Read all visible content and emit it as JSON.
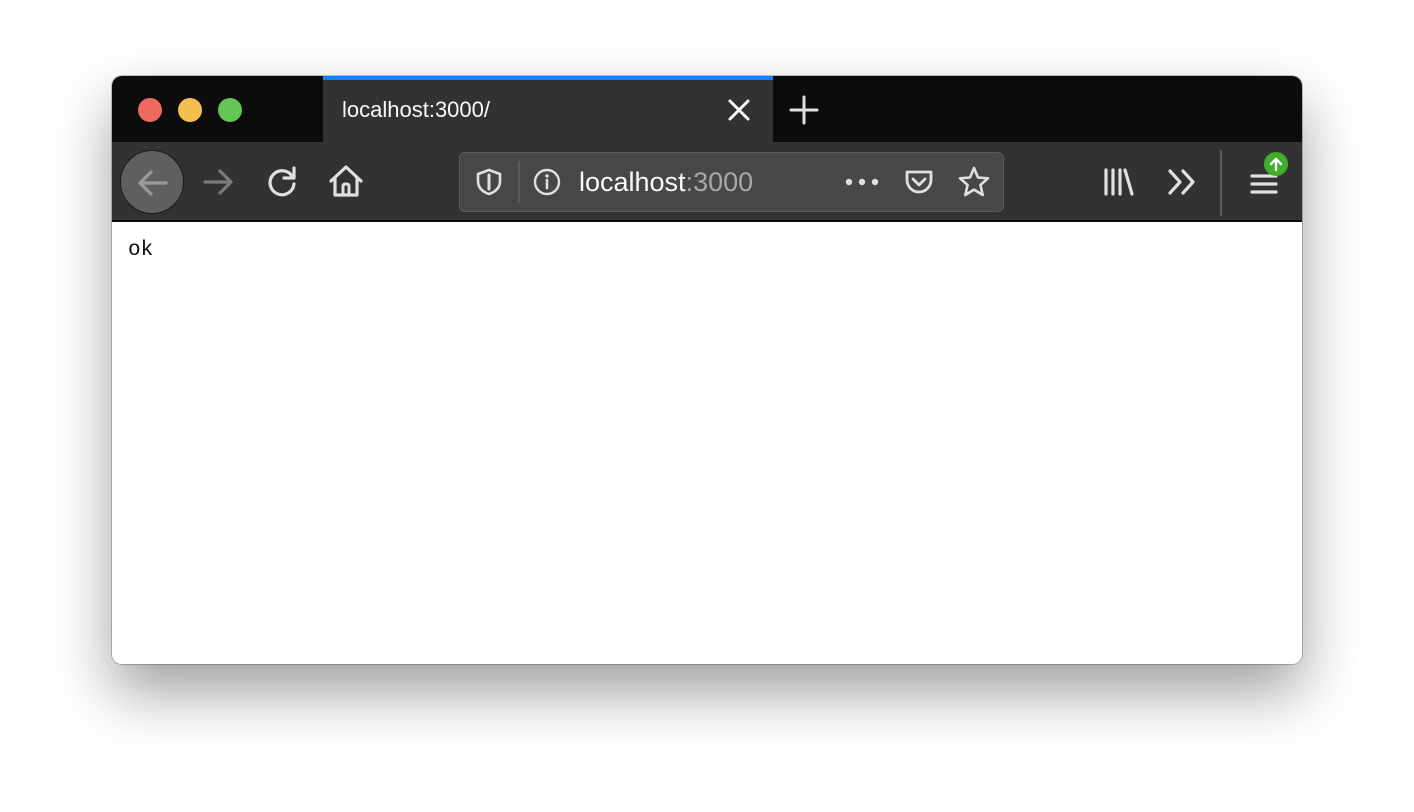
{
  "tab": {
    "title": "localhost:3000/"
  },
  "urlbar": {
    "host": "localhost",
    "port": ":3000"
  },
  "page": {
    "body_text": "ok"
  },
  "icons": {
    "close": "close-icon",
    "new_tab": "plus-icon",
    "back": "arrow-left-icon",
    "forward": "arrow-right-icon",
    "reload": "reload-icon",
    "home": "home-icon",
    "tracking": "shield-icon",
    "site_info": "info-icon",
    "page_actions": "ellipsis-icon",
    "pocket": "pocket-icon",
    "bookmark": "star-icon",
    "library": "library-icon",
    "overflow": "double-chevron-icon",
    "menu": "hamburger-icon",
    "update": "arrow-up-icon"
  },
  "colors": {
    "tab_active": "#323234",
    "tab_accent": "#0a84ff",
    "toolbar": "#323234",
    "titlebar": "#0c0c0d",
    "urlbar": "#474749",
    "update_badge": "#3fae2a"
  }
}
